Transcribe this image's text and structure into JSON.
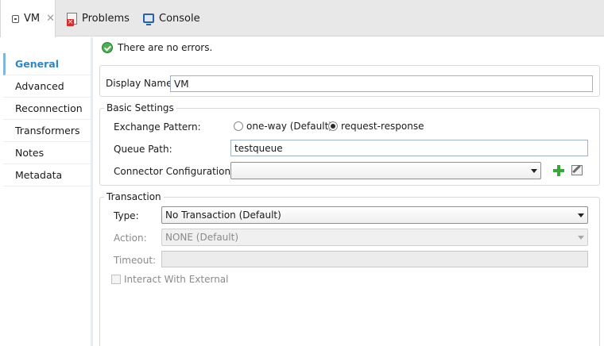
{
  "tabs": [
    {
      "label": "VM",
      "icon": "vm-icon",
      "active": true
    },
    {
      "label": "Problems",
      "icon": "problems-icon"
    },
    {
      "label": "Console",
      "icon": "console-icon"
    }
  ],
  "sidebar": {
    "items": [
      {
        "label": "General",
        "active": true
      },
      {
        "label": "Advanced"
      },
      {
        "label": "Reconnection"
      },
      {
        "label": "Transformers"
      },
      {
        "label": "Notes"
      },
      {
        "label": "Metadata"
      }
    ]
  },
  "status": {
    "message": "There are no errors.",
    "icon": "check-circle-icon",
    "color": "#4caf50"
  },
  "display": {
    "label": "Display Name:",
    "value": "VM"
  },
  "basic": {
    "legend": "Basic Settings",
    "exchange_label": "Exchange Pattern:",
    "options": [
      {
        "label": "one-way (Default)",
        "selected": false
      },
      {
        "label": "request-response",
        "selected": true
      }
    ],
    "queue_label": "Queue Path:",
    "queue_value": "testqueue",
    "connector_label": "Connector Configuration:",
    "connector_value": ""
  },
  "transaction": {
    "legend": "Transaction",
    "type_label": "Type:",
    "type_value": "No Transaction (Default)",
    "action_label": "Action:",
    "action_value": "NONE (Default)",
    "timeout_label": "Timeout:",
    "timeout_value": "",
    "interact_label": "Interact With External",
    "interact_checked": false
  },
  "colors": {
    "accent": "#2f86c6",
    "ok": "#4caf50",
    "add": "#3aa63a"
  }
}
